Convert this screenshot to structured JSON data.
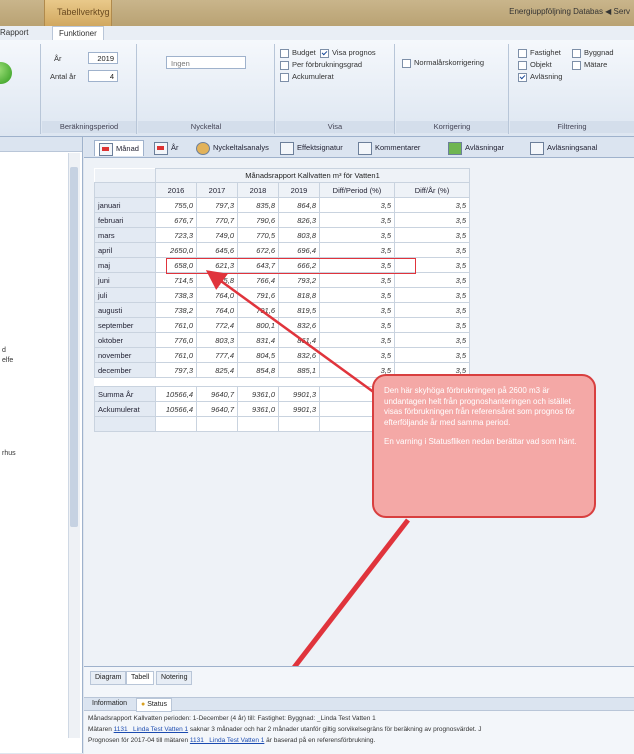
{
  "app": {
    "context_tab": "Tabellverktyg",
    "top_right": "Energiuppföljning  Databas  ◀  Serv"
  },
  "tabs": [
    {
      "label": "Rapport"
    },
    {
      "label": "Funktioner"
    }
  ],
  "ribbon": {
    "year_label": "År",
    "year_value": "2019",
    "count_label": "Antal år",
    "count_value": "4",
    "group_period": "Beräkningsperiod",
    "group_nyckeltal": "Nyckeltal",
    "group_visa": "Visa",
    "group_korrigering": "Korrigering",
    "group_filtrering": "Filtrering",
    "nyckeltal_combo": "Ingen",
    "visa": {
      "budget": "Budget",
      "visa_prognos": "Visa prognos",
      "per_forbrukning": "Per förbrukningsgrad",
      "ackumulerat": "Ackumulerat"
    },
    "korrigering": {
      "normalarskorrigering": "Normalårskorrigering"
    },
    "filtrering": {
      "fastighet": "Fastighet",
      "byggnad": "Byggnad",
      "objekt": "Objekt",
      "matare": "Mätare",
      "avlasning": "Avläsning"
    }
  },
  "left": {
    "t1": "d",
    "t2": "elfe",
    "t3": "rhus"
  },
  "views": [
    {
      "label": "Månad",
      "icon": "red-chart-icon"
    },
    {
      "label": "År",
      "icon": "red-chart-icon"
    },
    {
      "label": "Nyckeltalsanalys",
      "icon": "people-icon"
    },
    {
      "label": "Effektsignatur",
      "icon": "chart-icon"
    },
    {
      "label": "Kommentarer",
      "icon": "comment-icon"
    },
    {
      "label": "Avläsningar",
      "icon": "green-table-icon"
    },
    {
      "label": "Avläsningsanal",
      "icon": "chart-icon"
    }
  ],
  "table": {
    "title": "Månadsrapport Kallvatten  m³ för Vatten1",
    "headers": [
      "2016",
      "2017",
      "2018",
      "2019",
      "Diff/Period (%)",
      "Diff/År (%)"
    ],
    "rows": [
      {
        "m": "januari",
        "v": [
          "755,0",
          "797,3",
          "835,8",
          "864,8",
          "3,5",
          "3,5"
        ]
      },
      {
        "m": "februari",
        "v": [
          "676,7",
          "770,7",
          "790,6",
          "826,3",
          "3,5",
          "3,5"
        ]
      },
      {
        "m": "mars",
        "v": [
          "723,3",
          "749,0",
          "770,5",
          "803,8",
          "3,5",
          "3,5"
        ]
      },
      {
        "m": "april",
        "v": [
          "2650,0",
          "645,6",
          "672,6",
          "696,4",
          "3,5",
          "3,5"
        ]
      },
      {
        "m": "maj",
        "v": [
          "658,0",
          "621,3",
          "643,7",
          "666,2",
          "3,5",
          "3,5"
        ]
      },
      {
        "m": "juni",
        "v": [
          "714,5",
          "735,8",
          "766,4",
          "793,2",
          "3,5",
          "3,5"
        ]
      },
      {
        "m": "juli",
        "v": [
          "738,3",
          "764,0",
          "791,6",
          "818,8",
          "3,5",
          "3,5"
        ]
      },
      {
        "m": "augusti",
        "v": [
          "738,2",
          "764,0",
          "791,6",
          "819,5",
          "3,5",
          "3,5"
        ]
      },
      {
        "m": "september",
        "v": [
          "761,0",
          "772,4",
          "800,1",
          "832,6",
          "3,5",
          "3,5"
        ]
      },
      {
        "m": "oktober",
        "v": [
          "776,0",
          "803,3",
          "831,4",
          "861,4",
          "3,5",
          "3,5"
        ]
      },
      {
        "m": "november",
        "v": [
          "761,0",
          "777,4",
          "804,5",
          "832,6",
          "3,5",
          "3,5"
        ]
      },
      {
        "m": "december",
        "v": [
          "797,3",
          "825,4",
          "854,8",
          "885,1",
          "3,5",
          "3,5"
        ]
      }
    ],
    "sum_label": "Summa År",
    "sum": [
      "10566,4",
      "9640,7",
      "9361,0",
      "9901,3"
    ],
    "acc_label": "Ackumulerat",
    "acc": [
      "10566,4",
      "9640,7",
      "9361,0",
      "9901,3"
    ]
  },
  "callout": {
    "p1": "Den här skyhöga förbrukningen på 2600 m3 är undantagen helt från prognoshanteringen och istället visas förbrukningen från referensåret som prognos för efterföljande år med samma period.",
    "p2": "En varning i Statusfliken nedan berättar vad som hänt."
  },
  "bottom": {
    "tabs": [
      "Diagram",
      "Tabell",
      "Notering"
    ],
    "info_tabs": [
      "Information",
      "Status"
    ],
    "s1": "Månadsrapport Kallvatten perioden: 1-December (4 år) till: Fastighet: Byggnad: _Linda Test Vatten 1",
    "s2a": "Mätaren ",
    "s2link": "1131 _Linda Test Vatten 1",
    "s2b": " saknar 3 månader och har 2 månader utanför giltig sorvikelsegräns för beräkning av prognosvärdet. J",
    "s3a": "Prognosen för 2017-04 till mätaren ",
    "s3link": "1131 _Linda Test Vatten 1",
    "s3b": " är baserad på en referensförbrukning."
  }
}
